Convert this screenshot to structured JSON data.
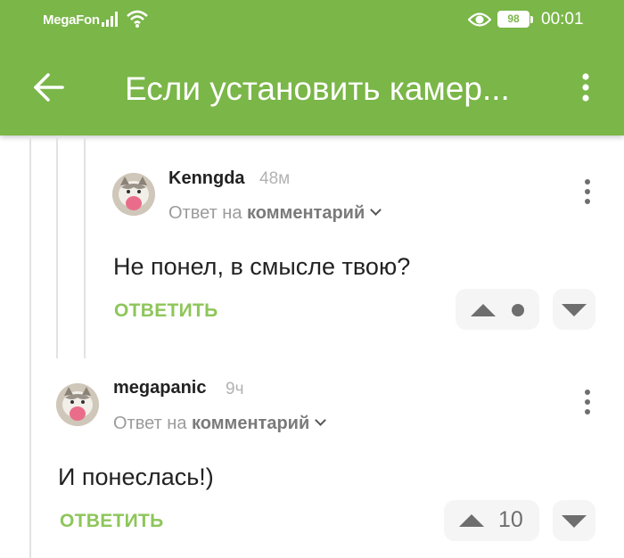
{
  "status_bar": {
    "carrier": "MegaFon",
    "battery": "98",
    "time": "00:01"
  },
  "app_bar": {
    "title": "Если установить камер..."
  },
  "comments": [
    {
      "author": "Kenngda",
      "time": "48м",
      "reply_prefix": "Ответ на",
      "reply_target": "комментарий",
      "text": "Не понел, в смысле твою?",
      "action": "ОТВЕТИТЬ",
      "score": ""
    },
    {
      "author": "megapanic",
      "time": "9ч",
      "reply_prefix": "Ответ на",
      "reply_target": "комментарий",
      "text": "И понеслась!)",
      "action": "ОТВЕТИТЬ",
      "score": "10"
    }
  ],
  "colors": {
    "brand": "#7ab648",
    "action": "#8dc65a"
  }
}
